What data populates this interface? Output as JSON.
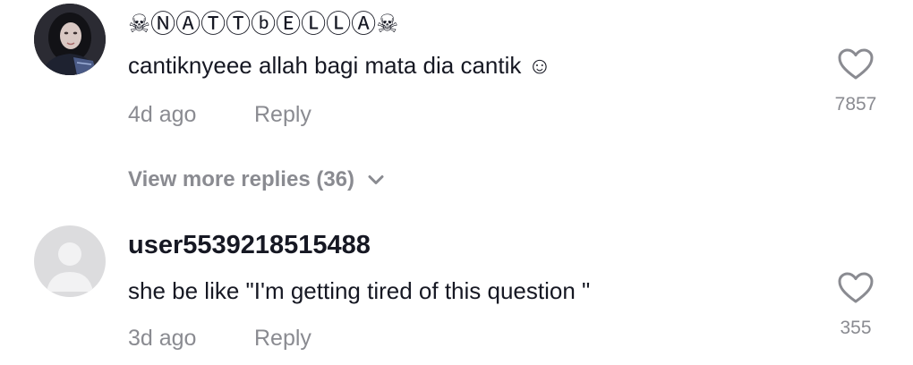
{
  "comments": [
    {
      "username": "☠ⓃⒶⓉⓉⓑⒺⓁⓁⒶ☠",
      "text": "cantiknyeee allah bagi mata dia cantik ☺",
      "time": "4d ago",
      "reply_label": "Reply",
      "likes": "7857",
      "avatar": "photo",
      "like_icon": "heart-outline-icon"
    },
    {
      "username": "user5539218515488",
      "text": "she be like \"I'm getting tired of this question \"",
      "time": "3d ago",
      "reply_label": "Reply",
      "likes": "355",
      "avatar": "default-user-icon",
      "like_icon": "heart-outline-icon"
    }
  ],
  "view_more": {
    "label": "View more replies (36)",
    "icon": "chevron-down-icon"
  },
  "colors": {
    "text": "#161823",
    "muted": "#8a8b91",
    "avatar_bg": "#dcdcde",
    "icon_stroke": "#8a8b91"
  }
}
